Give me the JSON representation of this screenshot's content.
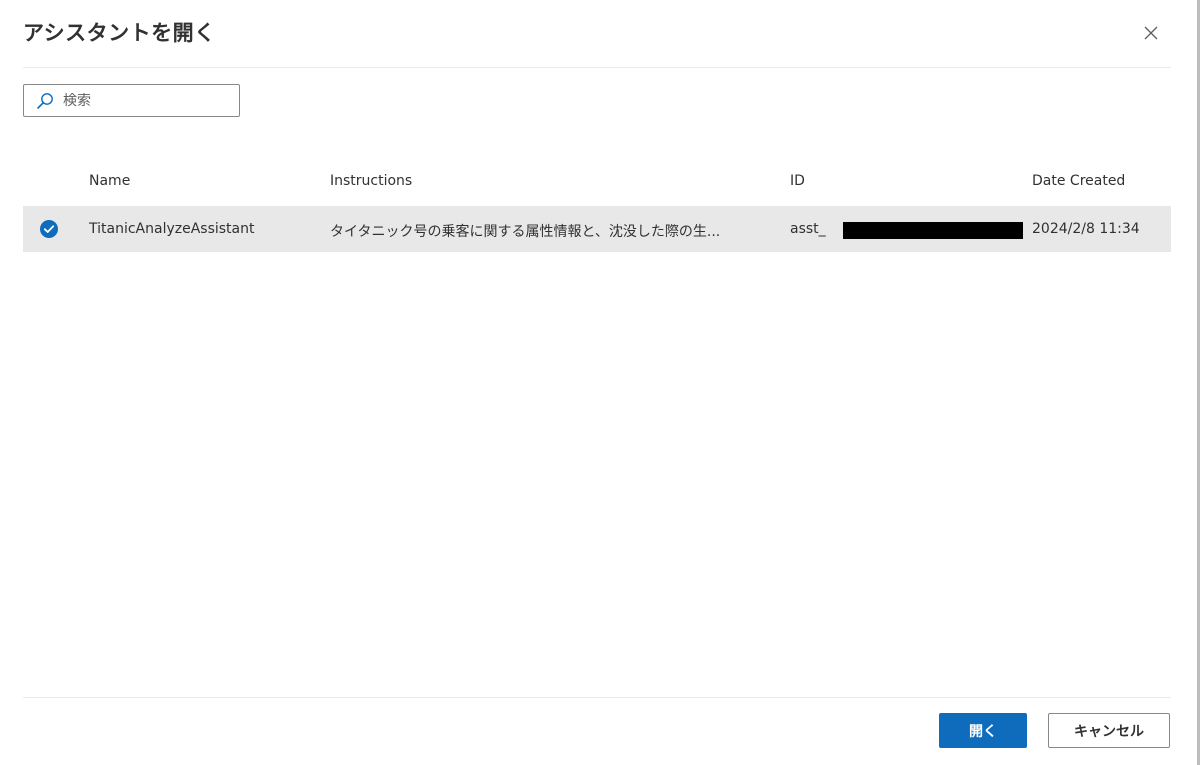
{
  "dialog": {
    "title": "アシスタントを開く",
    "close_icon": "close-icon"
  },
  "search": {
    "placeholder": "検索",
    "value": "",
    "icon": "search-icon"
  },
  "table": {
    "columns": [
      "Name",
      "Instructions",
      "ID",
      "Date Created"
    ],
    "rows": [
      {
        "selected": true,
        "name": "TitanicAnalyzeAssistant",
        "instructions": "タイタニック号の乗客に関する属性情報と、沈没した際の生...",
        "id": "asst_",
        "id_redacted": true,
        "date_created": "2024/2/8 11:34"
      }
    ]
  },
  "footer": {
    "open_label": "開く",
    "cancel_label": "キャンセル"
  },
  "colors": {
    "accent": "#0f6cbd",
    "selected_row": "#e8e8e8",
    "text": "#323130"
  }
}
